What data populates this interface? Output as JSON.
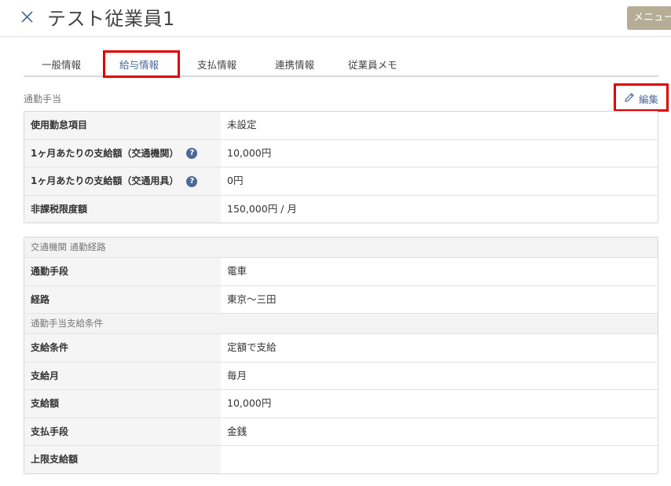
{
  "header": {
    "title": "テスト従業員1",
    "menu_label": "メニュー",
    "close_icon": "close-icon"
  },
  "tabs": [
    {
      "label": "一般情報",
      "active": false
    },
    {
      "label": "給与情報",
      "active": true
    },
    {
      "label": "支払情報",
      "active": false
    },
    {
      "label": "連携情報",
      "active": false
    },
    {
      "label": "従業員メモ",
      "active": false
    }
  ],
  "section": {
    "label": "通勤手当",
    "edit_label": "編集",
    "edit_icon": "pencil-icon"
  },
  "summary_table": [
    {
      "label": "使用勤怠項目",
      "value": "未設定",
      "help": false
    },
    {
      "label": "1ヶ月あたりの支給額（交通機関）",
      "value": "10,000円",
      "help": true
    },
    {
      "label": "1ヶ月あたりの支給額（交通用具）",
      "value": "0円",
      "help": true
    },
    {
      "label": "非課税限度額",
      "value": "150,000円 / 月",
      "help": false
    }
  ],
  "route_table": {
    "header": "交通機関 通勤経路",
    "rows": [
      {
        "label": "通勤手段",
        "value": "電車"
      },
      {
        "label": "経路",
        "value": "東京～三田"
      }
    ],
    "condition_header": "通勤手当支給条件",
    "condition_rows": [
      {
        "label": "支給条件",
        "value": "定額で支給"
      },
      {
        "label": "支給月",
        "value": "毎月"
      },
      {
        "label": "支給額",
        "value": "10,000円"
      },
      {
        "label": "支払手段",
        "value": "金銭"
      },
      {
        "label": "上限支給額",
        "value": ""
      }
    ]
  },
  "help_glyph": "?",
  "colors": {
    "accent": "#4a6a9c",
    "highlight_box": "#e00000",
    "menu_button": "#b5ad95"
  }
}
